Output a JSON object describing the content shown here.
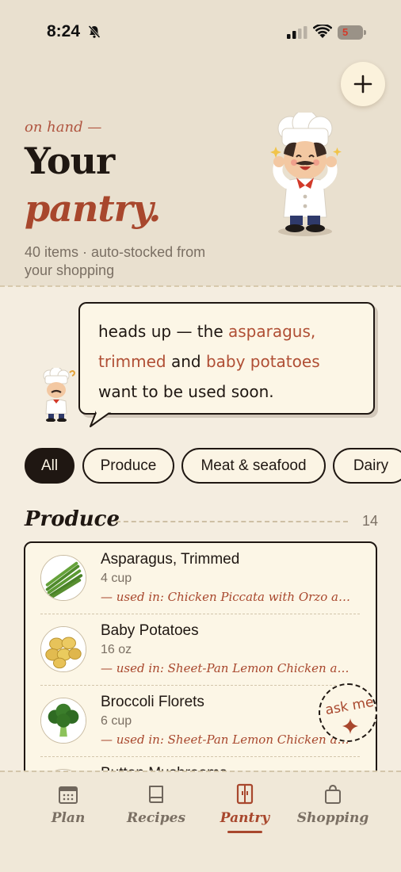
{
  "status": {
    "time": "8:24",
    "battery": "5"
  },
  "header": {
    "eyebrow": "on hand —",
    "title_line1": "Your",
    "title_line2": "pantry.",
    "subtitle": "40 items · auto-stocked from your shopping"
  },
  "bubble": {
    "p1": "heads up — the ",
    "h1": "asparagus, trimmed",
    "p2": " and ",
    "h2": "baby potatoes",
    "p3": " want to be used soon."
  },
  "filters": {
    "all": "All",
    "produce": "Produce",
    "meat": "Meat & seafood",
    "dairy": "Dairy"
  },
  "section": {
    "title": "Produce",
    "count": "14"
  },
  "items": [
    {
      "name": "Asparagus, Trimmed",
      "qty": "4 cup",
      "used": "— used in: Chicken Piccata with Orzo an..."
    },
    {
      "name": "Baby Potatoes",
      "qty": "16 oz",
      "used": "— used in: Sheet-Pan Lemon Chicken and..."
    },
    {
      "name": "Broccoli Florets",
      "qty": "6 cup",
      "used": "— used in: Sheet-Pan Lemon Chicken and..."
    },
    {
      "name": "Button Mushrooms"
    }
  ],
  "ask": {
    "label": "ask me"
  },
  "nav": {
    "plan": "Plan",
    "recipes": "Recipes",
    "pantry": "Pantry",
    "shopping": "Shopping"
  },
  "colors": {
    "accent": "#a8472d",
    "ink": "#1f1712",
    "paper": "#fcf6e6",
    "background": "#f4ede0"
  }
}
